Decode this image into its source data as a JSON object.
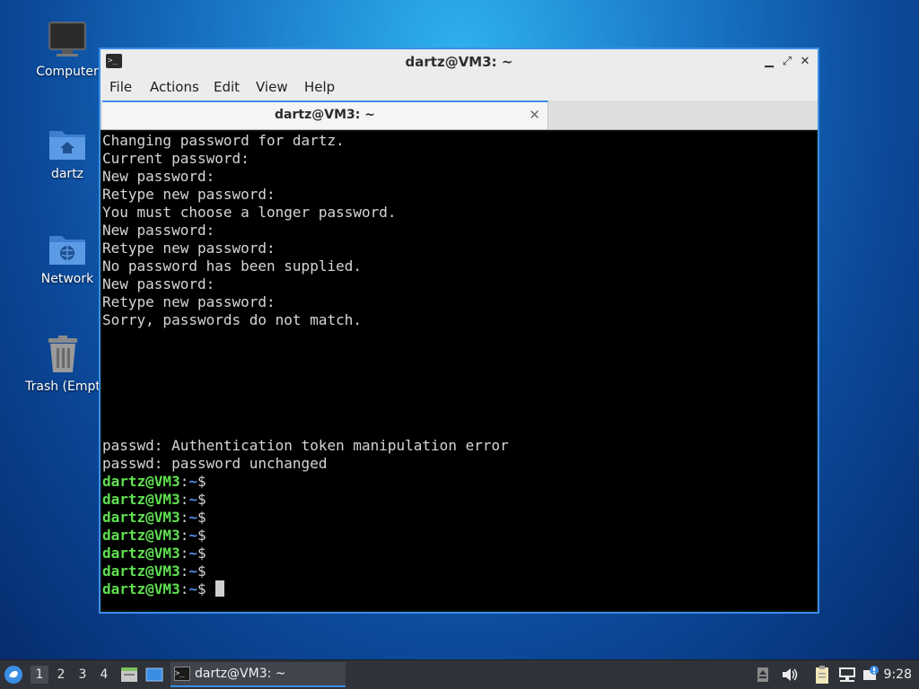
{
  "desktop": {
    "icons": [
      {
        "label": "Computer",
        "icon": "monitor-icon"
      },
      {
        "label": "dartz",
        "icon": "home-folder-icon"
      },
      {
        "label": "Network",
        "icon": "network-folder-icon"
      },
      {
        "label": "Trash (Empt",
        "icon": "trash-icon"
      }
    ]
  },
  "window": {
    "title": "dartz@VM3: ~",
    "buttons": {
      "minimize": "▁",
      "maximize": "⤢",
      "close": "✕"
    },
    "menu": [
      "File",
      "Actions",
      "Edit",
      "View",
      "Help"
    ],
    "tab": {
      "label": "dartz@VM3: ~",
      "close": "✕"
    }
  },
  "terminal": {
    "output_lines": [
      "Changing password for dartz.",
      "Current password:",
      "New password:",
      "Retype new password:",
      "You must choose a longer password.",
      "New password:",
      "Retype new password:",
      "No password has been supplied.",
      "New password:",
      "Retype new password:",
      "Sorry, passwords do not match.",
      "",
      "",
      "",
      "",
      "",
      "",
      "passwd: Authentication token manipulation error",
      "passwd: password unchanged"
    ],
    "prompt": {
      "user_host": "dartz@VM3",
      "separator": ":",
      "path": "~",
      "symbol": "$"
    },
    "prompt_count": 7,
    "colors": {
      "user_host": "#5fe04f",
      "path": "#4f8fe6",
      "text": "#d6d6d6",
      "background": "#000000"
    }
  },
  "taskbar": {
    "workspaces": [
      "1",
      "2",
      "3",
      "4"
    ],
    "active_workspace": "1",
    "task": {
      "label": "dartz@VM3: ~"
    },
    "tray_icons": [
      "eject-icon",
      "volume-icon",
      "clipboard-icon",
      "network-icon",
      "update-icon"
    ],
    "clock": "9:28"
  },
  "colors": {
    "accent": "#3a8ee6",
    "taskbar": "#2f3238"
  }
}
